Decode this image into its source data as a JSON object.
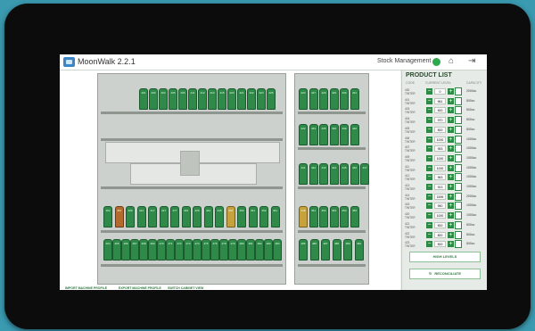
{
  "app": {
    "title": "MoonWalk 2.2.1",
    "page_title": "Stock Management",
    "status_color": "#2fa84f"
  },
  "cabinet_a": {
    "top_row": [
      "401",
      "403",
      "404",
      "405",
      "406",
      "411",
      "412",
      "413",
      "415",
      "420",
      "421",
      "422",
      "423",
      "425"
    ],
    "bottom_row1": [
      "462",
      "463",
      "409",
      "414",
      "417",
      "427",
      "477",
      "419",
      "426",
      "444",
      "446",
      "448",
      "450",
      "451",
      "452",
      "461"
    ],
    "bottom_row2": [
      "464",
      "465",
      "466",
      "467",
      "468",
      "469",
      "470",
      "471",
      "472",
      "473",
      "474",
      "475",
      "476",
      "478",
      "479",
      "480",
      "481",
      "482",
      "483",
      "484"
    ]
  },
  "cabinet_b": {
    "rows": [
      [
        "424",
        "427",
        "429",
        "429",
        "430",
        "431"
      ],
      [
        "432",
        "433",
        "435",
        "436",
        "439",
        "440"
      ],
      [
        "441",
        "442",
        "443",
        "444",
        "445",
        "446",
        "447"
      ],
      [
        "448",
        "451",
        "452",
        "453",
        "454",
        "455"
      ],
      [
        "485",
        "486",
        "487",
        "488",
        "489",
        "490"
      ],
      [
        "491",
        "492",
        "493",
        "494",
        "495",
        "496"
      ]
    ]
  },
  "footer": {
    "import_machine": "IMPORT MACHINE PROFILE",
    "export_machine": "EXPORT MACHINE PROFILE",
    "switch_view": "SWITCH CABINET VIEW"
  },
  "product_list": {
    "title": "PRODUCT LIST",
    "col_code": "CODE",
    "col_current": "CURRENT LEVEL",
    "col_capacity": "CAPACITY",
    "items": [
      {
        "code": "430",
        "sub": "TINTER",
        "value": "0",
        "capacity": "2000cc"
      },
      {
        "code": "401",
        "sub": "TINTER",
        "value": "961",
        "capacity": "500cc"
      },
      {
        "code": "403",
        "sub": "TINTER",
        "value": "500",
        "capacity": "500cc"
      },
      {
        "code": "404",
        "sub": "TINTER",
        "value": "970",
        "capacity": "500cc"
      },
      {
        "code": "405",
        "sub": "TINTER",
        "value": "500",
        "capacity": "500cc"
      },
      {
        "code": "406",
        "sub": "TINTER",
        "value": "1000",
        "capacity": "1000cc"
      },
      {
        "code": "407",
        "sub": "TINTER",
        "value": "953",
        "capacity": "1000cc"
      },
      {
        "code": "409",
        "sub": "TINTER",
        "value": "1000",
        "capacity": "1000cc"
      },
      {
        "code": "411",
        "sub": "TINTER",
        "value": "1000",
        "capacity": "1000cc"
      },
      {
        "code": "412",
        "sub": "TINTER",
        "value": "963",
        "capacity": "1000cc"
      },
      {
        "code": "413",
        "sub": "TINTER",
        "value": "913",
        "capacity": "1000cc"
      },
      {
        "code": "414",
        "sub": "TINTER",
        "value": "1599",
        "capacity": "2000cc"
      },
      {
        "code": "415",
        "sub": "TINTER",
        "value": "950",
        "capacity": "1000cc"
      },
      {
        "code": "420",
        "sub": "TINTER",
        "value": "1000",
        "capacity": "1000cc"
      },
      {
        "code": "421",
        "sub": "TINTER",
        "value": "500",
        "capacity": "500cc"
      },
      {
        "code": "422",
        "sub": "TINTER",
        "value": "800",
        "capacity": "500cc"
      },
      {
        "code": "423",
        "sub": "TINTER",
        "value": "500",
        "capacity": "500cc"
      }
    ],
    "high_levels": "HIGH LEVELS",
    "reconciliate": "RECONCILIATE"
  }
}
